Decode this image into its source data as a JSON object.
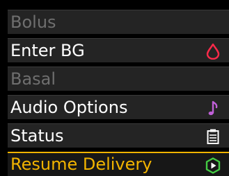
{
  "menu": {
    "items": [
      {
        "label": "Bolus",
        "state": "disabled",
        "icon": null
      },
      {
        "label": "Enter BG",
        "state": "enabled",
        "icon": "blood-drop-icon"
      },
      {
        "label": "Basal",
        "state": "disabled",
        "icon": null
      },
      {
        "label": "Audio Options",
        "state": "enabled",
        "icon": "music-note-icon"
      },
      {
        "label": "Status",
        "state": "enabled",
        "icon": "clipboard-icon"
      },
      {
        "label": "Resume Delivery",
        "state": "selected",
        "icon": "play-circle-icon"
      }
    ]
  },
  "colors": {
    "background": "#000000",
    "row_background": "#242424",
    "text": "#ffffff",
    "disabled_text": "#6f6f6f",
    "selected_accent": "#f2b400",
    "drop_icon": "#ff2a4a",
    "note_icon": "#c060d8",
    "play_icon": "#44cc44"
  }
}
